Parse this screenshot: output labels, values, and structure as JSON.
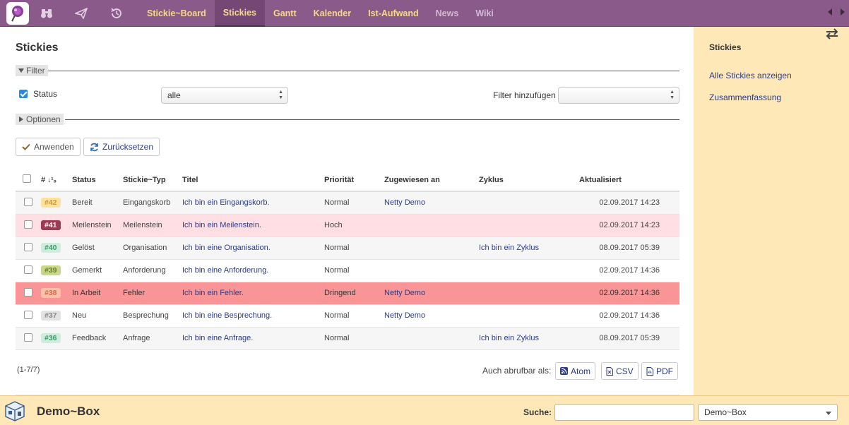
{
  "topnav": {
    "items": [
      {
        "label": "Stickie~Board",
        "state": "normal"
      },
      {
        "label": "Stickies",
        "state": "active"
      },
      {
        "label": "Gantt",
        "state": "normal"
      },
      {
        "label": "Kalender",
        "state": "normal"
      },
      {
        "label": "Ist-Aufwand",
        "state": "normal"
      },
      {
        "label": "News",
        "state": "dim"
      },
      {
        "label": "Wiki",
        "state": "dim"
      }
    ],
    "icons": [
      "binoculars-icon",
      "paper-plane-icon",
      "history-icon"
    ]
  },
  "main": {
    "title": "Stickies",
    "filter": {
      "legend": "Filter",
      "status_label": "Status",
      "status_checked": true,
      "status_value": "alle",
      "add_filter_label": "Filter hinzufügen",
      "add_filter_value": ""
    },
    "options": {
      "legend": "Optionen"
    },
    "buttons": {
      "apply": "Anwenden",
      "reset": "Zurücksetzen"
    },
    "table": {
      "headers": [
        "#",
        "Status",
        "Stickie~Typ",
        "Titel",
        "Priorität",
        "Zugewiesen an",
        "Zyklus",
        "Aktualisiert"
      ],
      "rows": [
        {
          "id": "#42",
          "badge_bg": "#ffe0a0",
          "badge_fg": "#c99a2a",
          "status": "Bereit",
          "type": "Eingangskorb",
          "title": "Ich bin ein Eingangskorb.",
          "priority": "Normal",
          "assignee": "Netty Demo",
          "cycle": "",
          "updated": "02.09.2017 14:23",
          "style": "odd"
        },
        {
          "id": "#41",
          "badge_bg": "#9a3a54",
          "badge_fg": "#ffffff",
          "status": "Meilenstein",
          "type": "Meilenstein",
          "title": "Ich bin ein Meilenstein.",
          "priority": "Hoch",
          "assignee": "",
          "cycle": "",
          "updated": "02.09.2017 14:23",
          "style": "high"
        },
        {
          "id": "#40",
          "badge_bg": "#cdeedd",
          "badge_fg": "#3a9a6a",
          "status": "Gelöst",
          "type": "Organisation",
          "title": "Ich bin eine Organisation.",
          "priority": "Normal",
          "assignee": "",
          "cycle": "Ich bin ein Zyklus",
          "updated": "08.09.2017 05:39",
          "style": "odd"
        },
        {
          "id": "#39",
          "badge_bg": "#c8d88a",
          "badge_fg": "#6a7a2a",
          "status": "Gemerkt",
          "type": "Anforderung",
          "title": "Ich bin eine Anforderung.",
          "priority": "Normal",
          "assignee": "",
          "cycle": "",
          "updated": "02.09.2017 14:36",
          "style": "even"
        },
        {
          "id": "#38",
          "badge_bg": "#ffc0a8",
          "badge_fg": "#d26a4a",
          "status": "In Arbeit",
          "type": "Fehler",
          "title": "Ich bin ein Fehler.",
          "priority": "Dringend",
          "assignee": "Netty Demo",
          "cycle": "",
          "updated": "02.09.2017 14:36",
          "style": "urgent"
        },
        {
          "id": "#37",
          "badge_bg": "#e2e2e2",
          "badge_fg": "#888888",
          "status": "Neu",
          "type": "Besprechung",
          "title": "Ich bin eine Besprechung.",
          "priority": "Normal",
          "assignee": "Netty Demo",
          "cycle": "",
          "updated": "02.09.2017 14:36",
          "style": "even"
        },
        {
          "id": "#36",
          "badge_bg": "#cdeedd",
          "badge_fg": "#3a9a6a",
          "status": "Feedback",
          "type": "Anfrage",
          "title": "Ich bin eine Anfrage.",
          "priority": "Normal",
          "assignee": "",
          "cycle": "Ich bin ein Zyklus",
          "updated": "08.09.2017 05:39",
          "style": "odd"
        }
      ]
    },
    "pagination": "(1-7/7)",
    "export": {
      "label": "Auch abrufbar als:",
      "atom": "Atom",
      "csv": "CSV",
      "pdf": "PDF"
    }
  },
  "sidebar": {
    "title": "Stickies",
    "links": [
      "Alle Stickies anzeigen",
      "Zusammenfassung"
    ]
  },
  "footer": {
    "title": "Demo~Box",
    "search_label": "Suche:",
    "search_value": "",
    "project_value": "Demo~Box"
  }
}
